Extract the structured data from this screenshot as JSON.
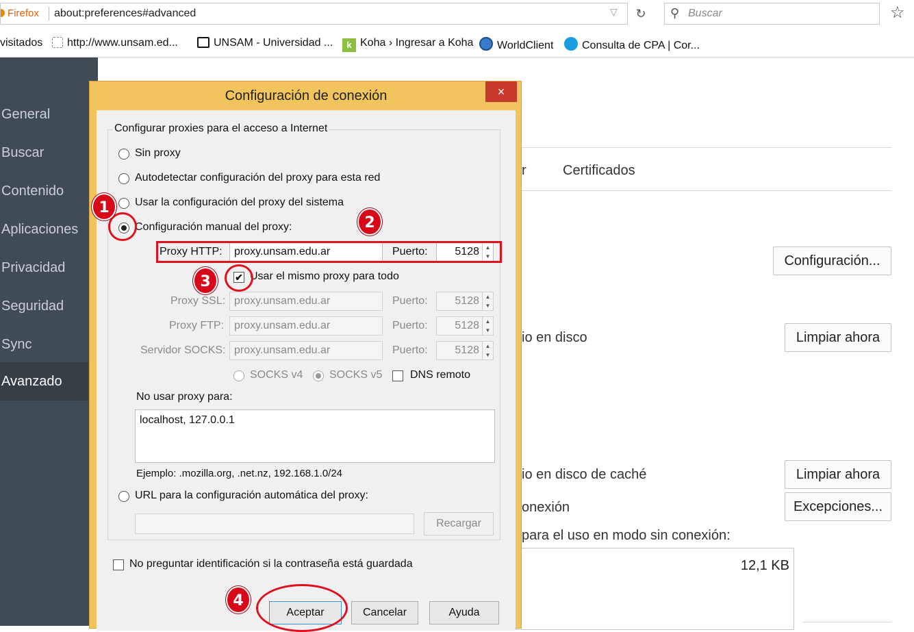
{
  "browser": {
    "brand": "Firefox",
    "url": "about:preferences#advanced",
    "search_placeholder": "Buscar"
  },
  "bookmarks": [
    {
      "label": "visitados",
      "icon": "folder-icon"
    },
    {
      "label": "http://www.unsam.ed...",
      "icon": "page-icon"
    },
    {
      "label": "UNSAM - Universidad ...",
      "icon": "book-icon"
    },
    {
      "label": "Koha › Ingresar a Koha",
      "icon": "koha-icon"
    },
    {
      "label": "WorldClient",
      "icon": "globe-icon"
    },
    {
      "label": "Consulta de CPA | Cor...",
      "icon": "cpa-icon"
    }
  ],
  "sidebar": {
    "items": [
      {
        "label": "General"
      },
      {
        "label": "Buscar"
      },
      {
        "label": "Contenido"
      },
      {
        "label": "Aplicaciones"
      },
      {
        "label": "Privacidad"
      },
      {
        "label": "Seguridad"
      },
      {
        "label": "Sync"
      },
      {
        "label": "Avanzado",
        "active": true
      }
    ]
  },
  "background": {
    "tab_partial": "r",
    "tab_certificados": "Certificados",
    "configuracion_button": "Configuración...",
    "cache_text": "io en disco",
    "limpiar_button_1": "Limpiar ahora",
    "offline_text": "io en disco de caché",
    "limpiar_button_2": "Limpiar ahora",
    "conexion_text": "onexión",
    "excepciones_button": "Excepciones...",
    "offline_use_text": "para el uso en modo sin conexión:",
    "size_value": "12,1 KB"
  },
  "dialog": {
    "title": "Configuración de conexión",
    "close": "×",
    "group_label": "Configurar proxies para el acceso a Internet",
    "opt_none": "Sin proxy",
    "opt_auto": "Autodetectar configuración del proxy para esta red",
    "opt_system": "Usar la configuración del proxy del sistema",
    "opt_manual": "Configuración manual del proxy:",
    "http_label": "Proxy HTTP:",
    "http_value": "proxy.unsam.edu.ar",
    "port_label": "Puerto:",
    "http_port": "5128",
    "same_proxy": "Usar el mismo proxy para todo",
    "ssl_label": "Proxy SSL:",
    "ssl_value": "proxy.unsam.edu.ar",
    "ssl_port": "5128",
    "ftp_label": "Proxy FTP:",
    "ftp_value": "proxy.unsam.edu.ar",
    "ftp_port": "5128",
    "socks_label": "Servidor SOCKS:",
    "socks_value": "proxy.unsam.edu.ar",
    "socks_port": "5128",
    "socks_v4": "SOCKS v4",
    "socks_v5": "SOCKS v5",
    "dns_remote": "DNS remoto",
    "no_proxy_label": "No usar proxy para:",
    "no_proxy_value": "localhost, 127.0.0.1",
    "example": "Ejemplo: .mozilla.org, .net.nz, 192.168.1.0/24",
    "opt_url": "URL para la configuración automática del proxy:",
    "url_value": "",
    "reload": "Recargar",
    "no_ask_auth": "No preguntar identificación si la contraseña está guardada",
    "ok": "Aceptar",
    "cancel": "Cancelar",
    "help": "Ayuda"
  },
  "annotations": [
    "1",
    "2",
    "3",
    "4"
  ],
  "colors": {
    "sidebar_bg": "#414b55",
    "dialog_frame": "#f1c45d",
    "close_red": "#c8392b",
    "annotation_red": "#e0101f"
  }
}
